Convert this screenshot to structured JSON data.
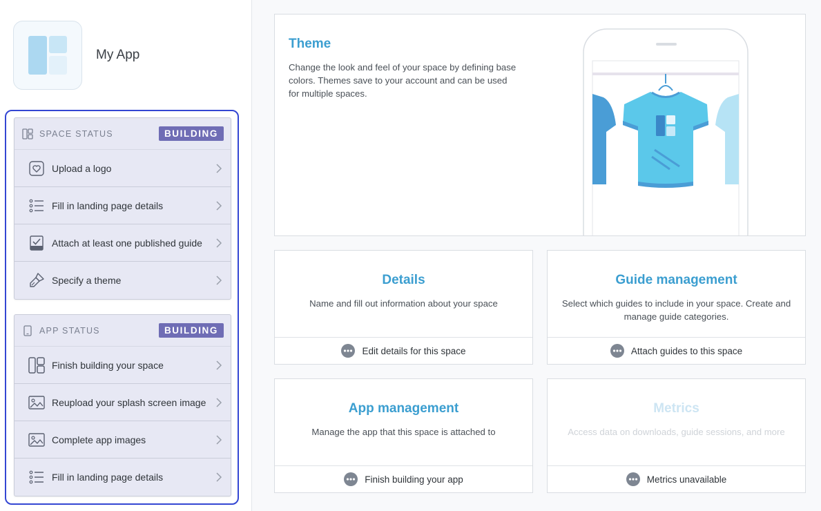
{
  "app": {
    "name": "My App"
  },
  "space_status": {
    "label": "SPACE STATUS",
    "badge": "BUILDING",
    "items": [
      {
        "label": "Upload a logo",
        "icon": "heart-frame-icon"
      },
      {
        "label": "Fill in landing page details",
        "icon": "list-icon"
      },
      {
        "label": "Attach at least one published guide",
        "icon": "checked-doc-icon"
      },
      {
        "label": "Specify a theme",
        "icon": "brush-icon"
      }
    ]
  },
  "app_status": {
    "label": "APP STATUS",
    "badge": "BUILDING",
    "items": [
      {
        "label": "Finish building your space",
        "icon": "layout-icon"
      },
      {
        "label": "Reupload your splash screen image",
        "icon": "image-icon"
      },
      {
        "label": "Complete app images",
        "icon": "image-icon"
      },
      {
        "label": "Fill in landing page details",
        "icon": "list-icon"
      }
    ]
  },
  "theme": {
    "title": "Theme",
    "description": "Change the look and feel of your space by defining base colors. Themes save to your account and can be used for multiple spaces."
  },
  "details": {
    "title": "Details",
    "description": "Name and fill out information about your space",
    "action": "Edit details for this space"
  },
  "guide_management": {
    "title": "Guide management",
    "description": "Select which guides to include in your space. Create and manage guide categories.",
    "action": "Attach guides to this space"
  },
  "app_management": {
    "title": "App management",
    "description": "Manage the app that this space is attached to",
    "action": "Finish building your app"
  },
  "metrics": {
    "title": "Metrics",
    "description": "Access data on downloads, guide sessions, and more",
    "action": "Metrics unavailable"
  },
  "colors": {
    "accent": "#3b9ed0",
    "badge": "#6f6db5",
    "highlight": "#3346d3",
    "shirt": "#5bc8ea"
  }
}
